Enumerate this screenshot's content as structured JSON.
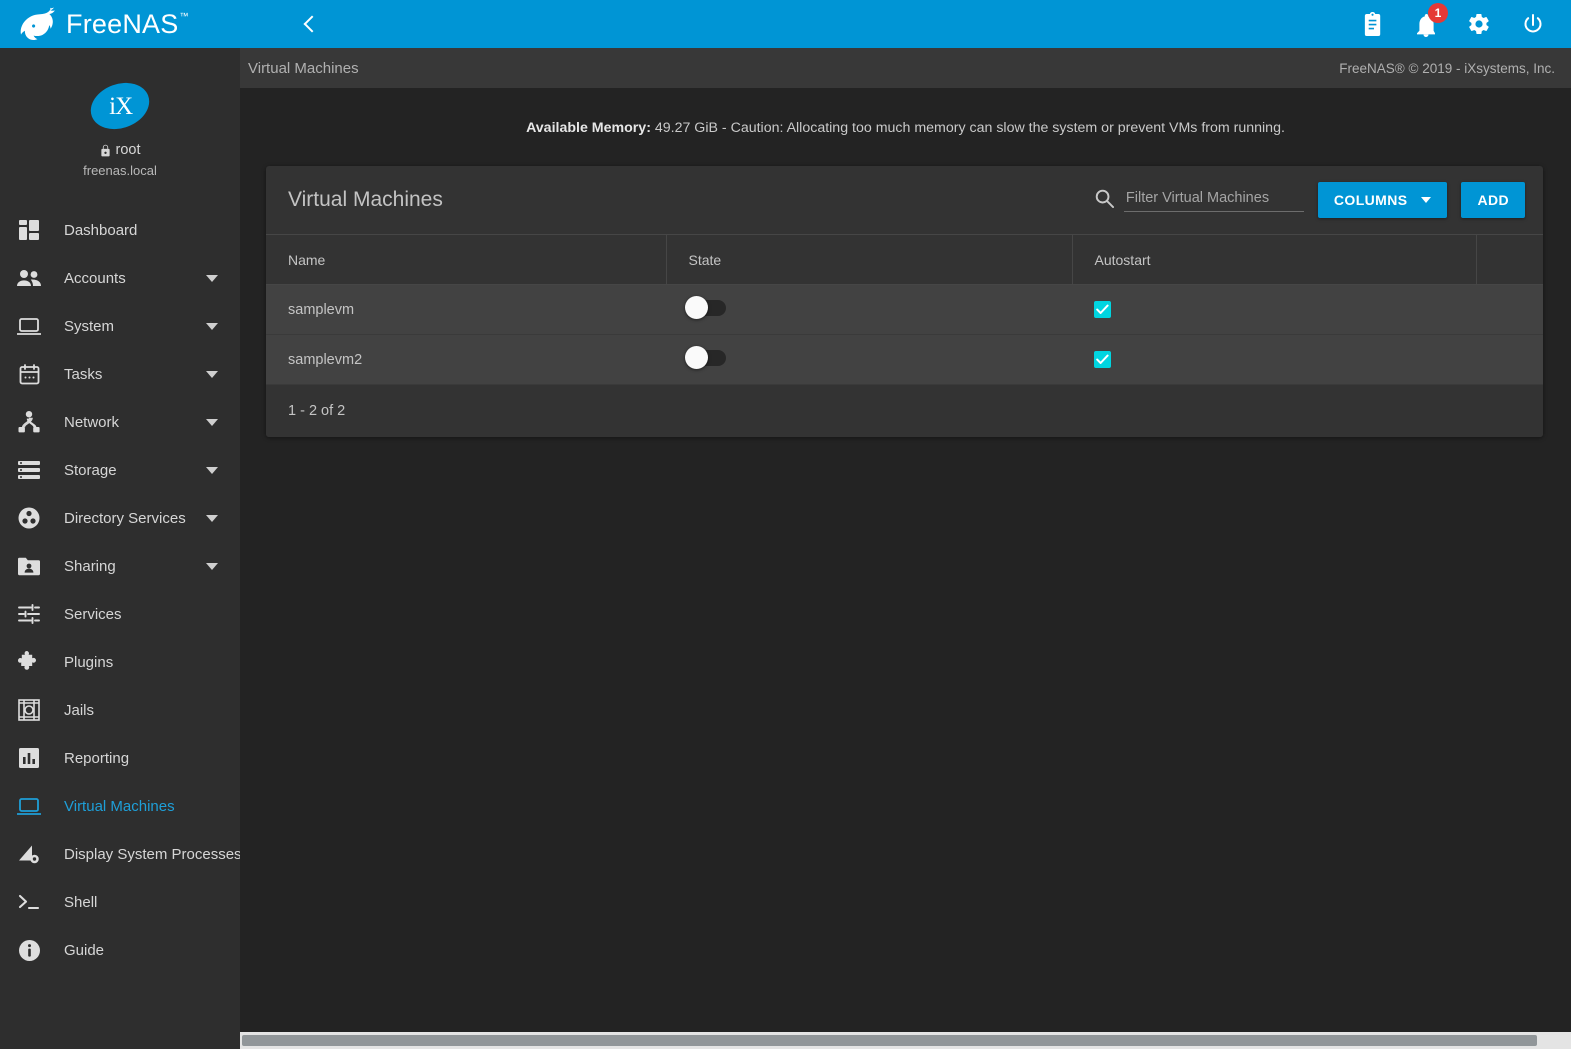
{
  "brand": {
    "logo_text": "FreeNAS",
    "logo_tm": "™",
    "accent_color": "#0095d5",
    "checkbox_color": "#00d5e0",
    "badge_color": "#e53935"
  },
  "topbar": {
    "menu_icon": "hamburger-icon",
    "collapse_icon": "chevron-left-icon",
    "icons": [
      {
        "name": "clipboard-icon",
        "label": "Tasks / Jobs"
      },
      {
        "name": "bell-icon",
        "label": "Alerts",
        "badge": "1"
      },
      {
        "name": "gear-icon",
        "label": "Settings"
      },
      {
        "name": "power-icon",
        "label": "Power"
      }
    ]
  },
  "sidebar": {
    "avatar": "iX",
    "username": "root",
    "hostname": "freenas.local",
    "lock_icon": "lock-icon",
    "items": [
      {
        "label": "Dashboard",
        "icon": "dashboard-icon",
        "expandable": false,
        "active": false
      },
      {
        "label": "Accounts",
        "icon": "accounts-icon",
        "expandable": true,
        "active": false
      },
      {
        "label": "System",
        "icon": "system-icon",
        "expandable": true,
        "active": false
      },
      {
        "label": "Tasks",
        "icon": "tasks-calendar-icon",
        "expandable": true,
        "active": false
      },
      {
        "label": "Network",
        "icon": "network-icon",
        "expandable": true,
        "active": false
      },
      {
        "label": "Storage",
        "icon": "storage-icon",
        "expandable": true,
        "active": false
      },
      {
        "label": "Directory Services",
        "icon": "directory-services-icon",
        "expandable": true,
        "active": false
      },
      {
        "label": "Sharing",
        "icon": "sharing-folder-icon",
        "expandable": true,
        "active": false
      },
      {
        "label": "Services",
        "icon": "services-sliders-icon",
        "expandable": false,
        "active": false
      },
      {
        "label": "Plugins",
        "icon": "plugins-puzzle-icon",
        "expandable": false,
        "active": false
      },
      {
        "label": "Jails",
        "icon": "jails-icon",
        "expandable": false,
        "active": false
      },
      {
        "label": "Reporting",
        "icon": "reporting-chart-icon",
        "expandable": false,
        "active": false
      },
      {
        "label": "Virtual Machines",
        "icon": "virtual-machines-icon",
        "expandable": false,
        "active": true
      },
      {
        "label": "Display System Processes",
        "icon": "display-processes-icon",
        "expandable": false,
        "active": false
      },
      {
        "label": "Shell",
        "icon": "shell-prompt-icon",
        "expandable": false,
        "active": false
      },
      {
        "label": "Guide",
        "icon": "guide-info-icon",
        "expandable": false,
        "active": false
      }
    ]
  },
  "breadcrumb": {
    "title": "Virtual Machines",
    "copyright": "FreeNAS® © 2019 - iXsystems, Inc."
  },
  "memory_note": {
    "label": "Available Memory:",
    "text": " 49.27 GiB - Caution: Allocating too much memory can slow the system or prevent VMs from running."
  },
  "card": {
    "title": "Virtual Machines",
    "search": {
      "icon": "search-icon",
      "placeholder": "Filter Virtual Machines",
      "value": ""
    },
    "columns_button": "COLUMNS",
    "add_button": "ADD",
    "table": {
      "headers": [
        "Name",
        "State",
        "Autostart",
        ""
      ],
      "rows": [
        {
          "name": "samplevm",
          "state_on": false,
          "autostart": true,
          "expand_icon": "chevron-right-icon"
        },
        {
          "name": "samplevm2",
          "state_on": false,
          "autostart": true,
          "expand_icon": "chevron-right-icon"
        }
      ]
    },
    "pagination": "1 - 2 of 2"
  },
  "scrollbar": {
    "name": "horizontal-scrollbar"
  }
}
